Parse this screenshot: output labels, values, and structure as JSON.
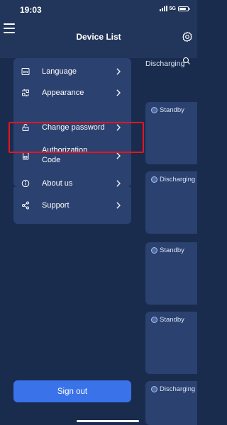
{
  "status_bar": {
    "time": "19:03",
    "network": "5G",
    "signal_icon": "signal-bars-icon",
    "battery_icon": "battery-icon"
  },
  "header": {
    "title": "Device List",
    "menu_icon": "menu-icon",
    "settings_icon": "gear-icon",
    "search_icon": "search-icon"
  },
  "background_list": {
    "top_status": "Discharging",
    "cards": [
      {
        "status": "Standby"
      },
      {
        "status": "Discharging"
      },
      {
        "status": "Standby"
      },
      {
        "status": "Standby"
      },
      {
        "status": "Discharging"
      }
    ]
  },
  "drawer": {
    "menu": [
      {
        "label": "Language",
        "icon": "language-en-icon"
      },
      {
        "label": "Appearance",
        "icon": "appearance-icon"
      },
      {
        "label": "Change password",
        "icon": "lock-icon"
      },
      {
        "label_line1": "Authorization",
        "label_line2": "Code",
        "icon": "sd-card-icon",
        "highlighted": true
      },
      {
        "label": "About us",
        "icon": "info-icon"
      },
      {
        "label": "Support",
        "icon": "share-icon"
      }
    ],
    "sign_out_label": "Sign out"
  },
  "colors": {
    "background": "#1a2c4d",
    "header": "#22355a",
    "panel": "#2b4170",
    "accent_button": "#3a72ea",
    "highlight_border": "#e8141e"
  }
}
